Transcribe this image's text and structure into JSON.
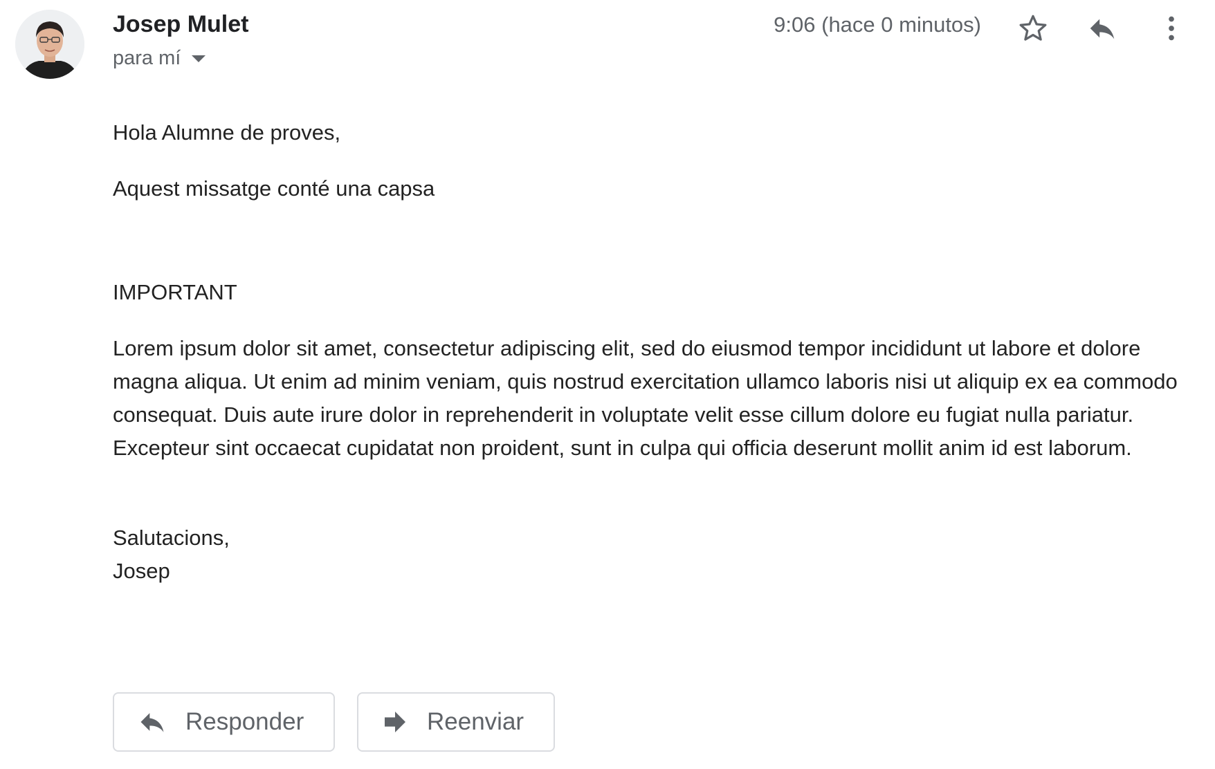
{
  "sender": {
    "name": "Josep Mulet",
    "recipient_label": "para mí"
  },
  "timestamp": "9:06 (hace 0 minutos)",
  "header_icons": [
    "star-icon",
    "reply-icon",
    "more-vert-icon"
  ],
  "body": {
    "greeting": "Hola Alumne de proves,",
    "intro": "Aquest missatge conté una capsa",
    "important": "IMPORTANT",
    "lorem": "Lorem ipsum dolor sit amet, consectetur adipiscing elit, sed do eiusmod tempor incididunt ut labore et dolore magna aliqua. Ut enim ad minim veniam, quis nostrud exercitation ullamco laboris nisi ut aliquip ex ea commodo consequat. Duis aute irure dolor in reprehenderit in voluptate velit esse cillum dolore eu fugiat nulla pariatur. Excepteur sint occaecat cupidatat non proident, sunt in culpa qui officia deserunt mollit anim id est laborum.",
    "closing": "Salutacions,",
    "signature": "Josep"
  },
  "actions": {
    "reply_label": "Responder",
    "forward_label": "Reenviar"
  },
  "colors": {
    "icon_gray": "#5f6368",
    "text": "#222222",
    "button_border": "#dadce0"
  }
}
